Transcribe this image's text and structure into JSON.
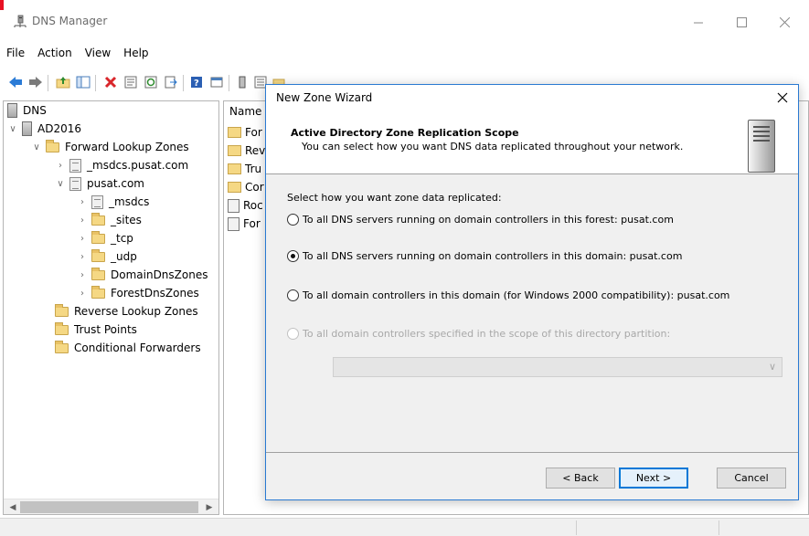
{
  "window": {
    "title": "DNS Manager"
  },
  "menu": [
    "File",
    "Action",
    "View",
    "Help"
  ],
  "tree": {
    "items": [
      {
        "label": "DNS",
        "icon": "dns-server-icon"
      },
      {
        "label": "AD2016",
        "icon": "server-icon"
      },
      {
        "label": "Forward Lookup Zones",
        "icon": "folder-icon"
      },
      {
        "label": "_msdcs.pusat.com",
        "icon": "zone-icon"
      },
      {
        "label": "pusat.com",
        "icon": "zone-icon"
      },
      {
        "label": "_msdcs",
        "icon": "zone-icon"
      },
      {
        "label": "_sites",
        "icon": "folder-icon"
      },
      {
        "label": "_tcp",
        "icon": "folder-icon"
      },
      {
        "label": "_udp",
        "icon": "folder-icon"
      },
      {
        "label": "DomainDnsZones",
        "icon": "folder-icon"
      },
      {
        "label": "ForestDnsZones",
        "icon": "folder-icon"
      },
      {
        "label": "Reverse Lookup Zones",
        "icon": "folder-icon"
      },
      {
        "label": "Trust Points",
        "icon": "folder-icon"
      },
      {
        "label": "Conditional Forwarders",
        "icon": "folder-icon"
      }
    ]
  },
  "list": {
    "header": "Name",
    "rows": [
      "For",
      "Rev",
      "Tru",
      "Cor",
      "Roc",
      "For"
    ]
  },
  "wizard": {
    "title": "New Zone Wizard",
    "heading": "Active Directory Zone Replication Scope",
    "subheading": "You can select how you want DNS data replicated throughout your network.",
    "prompt": "Select how you want zone data replicated:",
    "options": [
      {
        "label": "To all DNS servers running on domain controllers in this forest: pusat.com",
        "selected": false,
        "enabled": true
      },
      {
        "label": "To all DNS servers running on domain controllers in this domain: pusat.com",
        "selected": true,
        "enabled": true
      },
      {
        "label": "To all domain controllers in this domain (for Windows 2000 compatibility): pusat.com",
        "selected": false,
        "enabled": true
      },
      {
        "label": "To all domain controllers specified in the scope of this directory partition:",
        "selected": false,
        "enabled": false
      }
    ],
    "partition_value": "",
    "buttons": {
      "back": "< Back",
      "next": "Next >",
      "cancel": "Cancel"
    }
  },
  "colors": {
    "accent": "#0078d7",
    "folder": "#f5d884"
  }
}
